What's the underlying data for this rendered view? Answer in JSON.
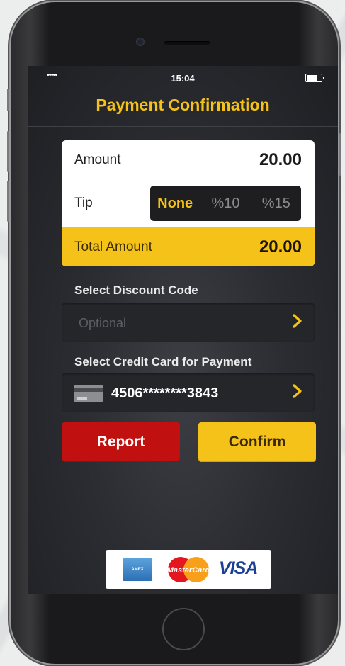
{
  "status_bar": {
    "signal": "•••••",
    "time": "15:04",
    "battery_level": 0.75
  },
  "header": {
    "title": "Payment Confirmation"
  },
  "summary": {
    "amount_label": "Amount",
    "amount_value": "20.00",
    "tip_label": "Tip",
    "tip_options": [
      "None",
      "%10",
      "%15"
    ],
    "tip_selected": "None",
    "total_label": "Total Amount",
    "total_value": "20.00"
  },
  "discount": {
    "label": "Select Discount Code",
    "placeholder": "Optional"
  },
  "credit_card": {
    "label": "Select Credit Card for Payment",
    "number": "4506********3843"
  },
  "actions": {
    "report_label": "Report",
    "confirm_label": "Confirm"
  },
  "accepted_cards": {
    "amex": "AMERICAN EXPRESS",
    "mastercard": "MasterCard",
    "visa": "VISA"
  },
  "colors": {
    "accent": "#f4c218",
    "danger": "#c0100f",
    "screen_bg": "#2c2d32"
  },
  "icons": [
    "chevron-right-icon",
    "credit-card-icon",
    "battery-icon"
  ]
}
